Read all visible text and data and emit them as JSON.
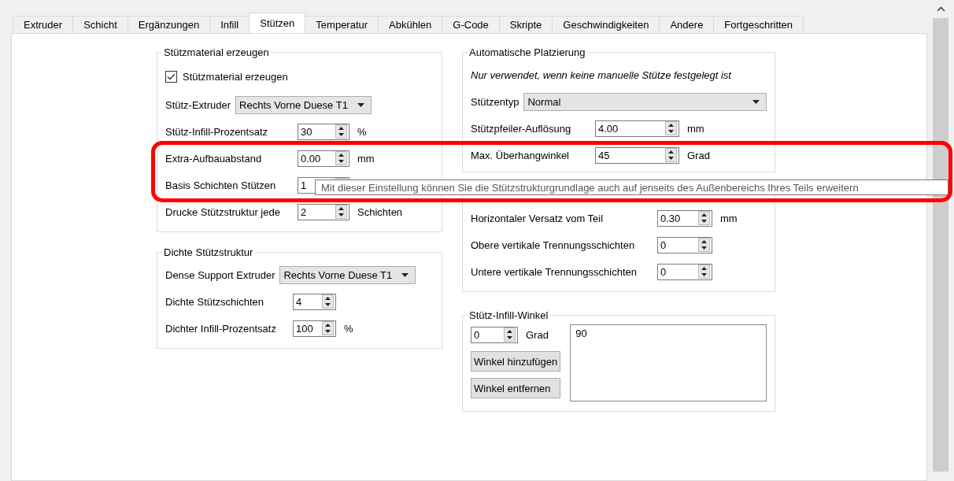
{
  "tabs": [
    {
      "label": "Extruder",
      "selected": false
    },
    {
      "label": "Schicht",
      "selected": false
    },
    {
      "label": "Ergänzungen",
      "selected": false
    },
    {
      "label": "Infill",
      "selected": false
    },
    {
      "label": "Stützen",
      "selected": true
    },
    {
      "label": "Temperatur",
      "selected": false
    },
    {
      "label": "Abkühlen",
      "selected": false
    },
    {
      "label": "G-Code",
      "selected": false
    },
    {
      "label": "Skripte",
      "selected": false
    },
    {
      "label": "Geschwindigkeiten",
      "selected": false
    },
    {
      "label": "Andere",
      "selected": false
    },
    {
      "label": "Fortgeschritten",
      "selected": false
    }
  ],
  "left_groups": [
    {
      "title": "Stützmaterial erzeugen",
      "rows": [
        {
          "kind": "checkbox",
          "label": "Stützmaterial erzeugen",
          "checked": true
        },
        {
          "kind": "combo",
          "label": "Stütz-Extruder",
          "value": "Rechts Vorne Duese T1"
        },
        {
          "kind": "spin",
          "label": "Stütz-Infill-Prozentsatz",
          "value": "30",
          "unit": "%"
        },
        {
          "kind": "spin",
          "label": "Extra-Aufbauabstand",
          "value": "0.00",
          "unit": "mm"
        },
        {
          "kind": "spin",
          "label": "Basis Schichten Stützen",
          "value": "1"
        },
        {
          "kind": "spin",
          "label": "Drucke Stützstruktur jede",
          "value": "2",
          "unit": "Schichten"
        }
      ]
    },
    {
      "title": "Dichte Stützstruktur",
      "rows": [
        {
          "kind": "combo",
          "label": "Dense Support Extruder",
          "value": "Rechts Vorne Duese T1"
        },
        {
          "kind": "spin",
          "label": "Dichte Stützschichten",
          "value": "4"
        },
        {
          "kind": "spin",
          "label": "Dichter Infill-Prozentsatz",
          "value": "100",
          "unit": "%"
        }
      ]
    }
  ],
  "right_groups": [
    {
      "title": "Automatische Platzierung",
      "rows": [
        {
          "kind": "note",
          "label": "Nur verwendet, wenn keine manuelle Stütze festgelegt ist"
        },
        {
          "kind": "combo",
          "label": "Stützentyp",
          "value": "Normal"
        },
        {
          "kind": "spin",
          "label": "Stützpfeiler-Auflösung",
          "value": "4.00",
          "unit": "mm"
        },
        {
          "kind": "spin",
          "label": "Max. Überhangwinkel",
          "value": "45",
          "unit": "Grad"
        }
      ]
    },
    {
      "rows": [
        {
          "kind": "spin",
          "label": "Horizontaler Versatz vom Teil",
          "value": "0.30",
          "unit": "mm"
        },
        {
          "kind": "spin",
          "label": "Obere vertikale Trennungsschichten",
          "value": "0"
        },
        {
          "kind": "spin",
          "label": "Untere vertikale Trennungsschichten",
          "value": "0"
        }
      ]
    }
  ],
  "angle_group": {
    "title": "Stütz-Infill-Winkel",
    "value": "0",
    "unit": "Grad",
    "buttons": [
      "Winkel hinzufügen",
      "Winkel entfernen"
    ],
    "list": [
      "90"
    ]
  },
  "tooltip": "Mit dieser Einstellung können Sie die Stützstrukturgrundlage auch auf jenseits des Außenbereichs Ihres Teils erweitern"
}
